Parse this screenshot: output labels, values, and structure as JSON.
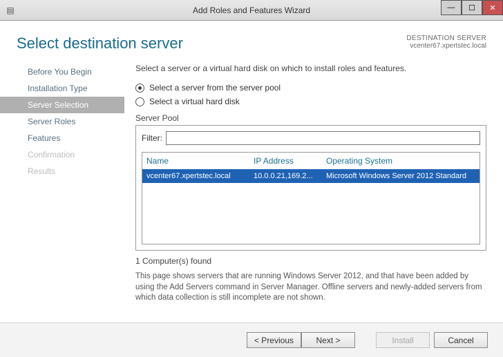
{
  "window": {
    "title": "Add Roles and Features Wizard"
  },
  "header": {
    "title": "Select destination server",
    "destination_label": "DESTINATION SERVER",
    "destination_value": "vcenter67.xpertstec.local"
  },
  "sidebar": {
    "items": [
      {
        "label": "Before You Begin",
        "state": "normal"
      },
      {
        "label": "Installation Type",
        "state": "normal"
      },
      {
        "label": "Server Selection",
        "state": "selected"
      },
      {
        "label": "Server Roles",
        "state": "normal"
      },
      {
        "label": "Features",
        "state": "normal"
      },
      {
        "label": "Confirmation",
        "state": "disabled"
      },
      {
        "label": "Results",
        "state": "disabled"
      }
    ]
  },
  "content": {
    "instruction": "Select a server or a virtual hard disk on which to install roles and features.",
    "radios": {
      "pool": "Select a server from the server pool",
      "vhd": "Select a virtual hard disk"
    },
    "pool_label": "Server Pool",
    "filter_label": "Filter:",
    "filter_value": "",
    "columns": {
      "name": "Name",
      "ip": "IP Address",
      "os": "Operating System"
    },
    "rows": [
      {
        "name": "vcenter67.xpertstec.local",
        "ip": "10.0.0.21,169.2...",
        "os": "Microsoft Windows Server 2012 Standard"
      }
    ],
    "found_text": "1 Computer(s) found",
    "hint_text": "This page shows servers that are running Windows Server 2012, and that have been added by using the Add Servers command in Server Manager. Offline servers and newly-added servers from which data collection is still incomplete are not shown."
  },
  "footer": {
    "previous": "< Previous",
    "next": "Next >",
    "install": "Install",
    "cancel": "Cancel"
  }
}
